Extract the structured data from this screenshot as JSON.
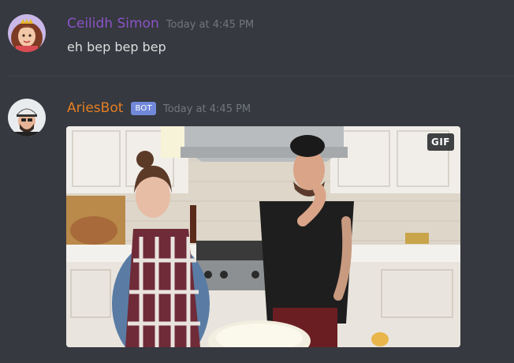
{
  "messages": [
    {
      "username": "Ceilidh Simon",
      "username_color": "#8b53c8",
      "timestamp": "Today at 4:45 PM",
      "text": "eh bep bep bep",
      "avatar": "girl-with-crown-avatar"
    },
    {
      "username": "AriesBot",
      "username_color": "#e67e22",
      "bot_tag": "BOT",
      "timestamp": "Today at 4:45 PM",
      "avatar": "man-in-cap-avatar",
      "attachment": {
        "type": "gif",
        "badge": "GIF",
        "scene": "kitchen-cooking-gif"
      }
    }
  ],
  "colors": {
    "background": "#36393f",
    "text": "#dcddde",
    "timestamp": "#72767d",
    "bot_tag": "#7289da"
  }
}
